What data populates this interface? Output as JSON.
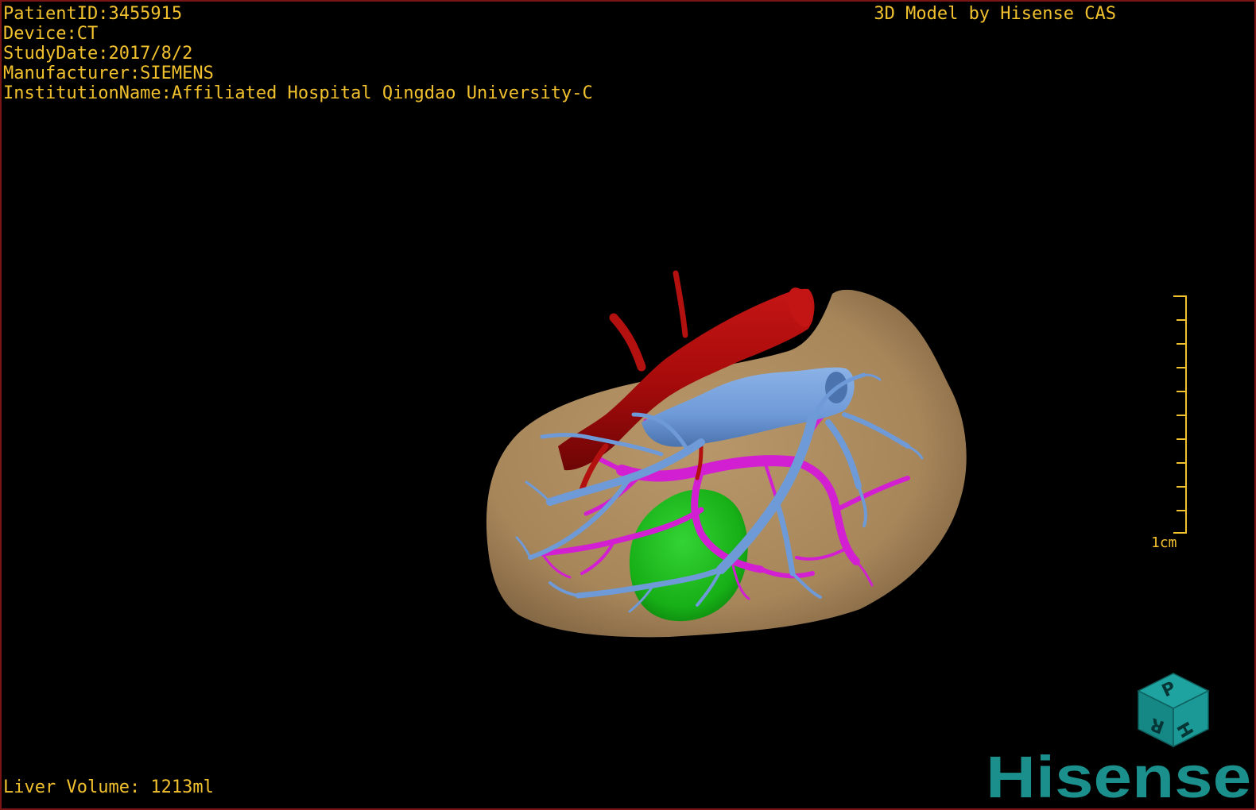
{
  "overlay": {
    "patient_id": "PatientID:3455915",
    "device": "Device:CT",
    "study_date": "StudyDate:2017/8/2",
    "manufacturer": "Manufacturer:SIEMENS",
    "institution": "InstitutionName:Affiliated Hospital Qingdao University-C",
    "credit": "3D Model by Hisense CAS",
    "liver_volume": "Liver Volume: 1213ml"
  },
  "scale_bar": {
    "label": "1cm"
  },
  "orientation_cube": {
    "faces": [
      "P",
      "H",
      "R"
    ]
  },
  "brand": {
    "name": "Hisense"
  },
  "model": {
    "structures": [
      {
        "name": "liver",
        "color": "#a7865a"
      },
      {
        "name": "hepatic-artery-aorta",
        "color": "#a80b0b"
      },
      {
        "name": "portal-vein",
        "color": "#6e9ad8"
      },
      {
        "name": "hepatic-vein",
        "color": "#d21fd2"
      },
      {
        "name": "lesion",
        "color": "#17b017"
      }
    ]
  },
  "colors": {
    "overlay_text": "#f2c12e",
    "frame_border": "#7a1515",
    "brand_teal": "#1a8f8c"
  }
}
